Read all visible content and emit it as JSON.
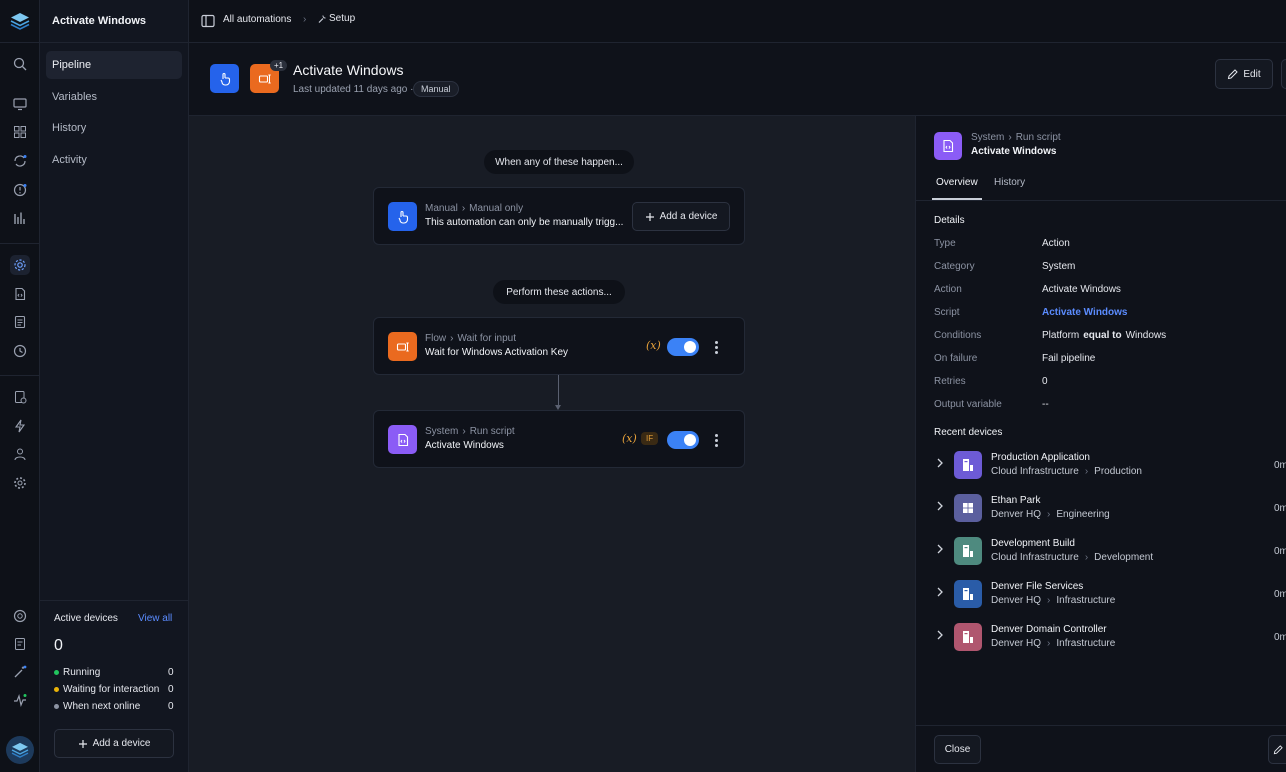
{
  "app": {
    "title": "Activate Windows"
  },
  "sidebar": {
    "nav": [
      {
        "label": "Pipeline"
      },
      {
        "label": "Variables"
      },
      {
        "label": "History"
      },
      {
        "label": "Activity"
      }
    ],
    "active_devices": {
      "title": "Active devices",
      "view_all": "View all",
      "count": "0",
      "statuses": [
        {
          "label": "Running",
          "value": "0",
          "color": "#22c55e"
        },
        {
          "label": "Waiting for interaction",
          "value": "0",
          "color": "#eab308"
        },
        {
          "label": "When next online",
          "value": "0",
          "color": "#8c93a3"
        }
      ],
      "add_button": "Add a device"
    }
  },
  "topbar": {
    "breadcrumb_root": "All automations",
    "breadcrumb_current": "Setup"
  },
  "header": {
    "title": "Activate Windows",
    "updated": "Last updated 11 days ago ·",
    "badge": "Manual",
    "plus_count": "+1",
    "edit_label": "Edit"
  },
  "canvas": {
    "trigger_heading": "When any of these happen...",
    "trigger": {
      "crumb_a": "Manual",
      "crumb_b": "Manual only",
      "desc": "This automation can only be manually trigg...",
      "add_device": "Add a device"
    },
    "actions_heading": "Perform these actions...",
    "actions": [
      {
        "crumb_a": "Flow",
        "crumb_b": "Wait for input",
        "title": "Wait for Windows Activation Key",
        "fx": "(x)"
      },
      {
        "crumb_a": "System",
        "crumb_b": "Run script",
        "title": "Activate Windows",
        "fx": "(x)",
        "if": "IF"
      }
    ]
  },
  "panel": {
    "crumb_a": "System",
    "crumb_b": "Run script",
    "title": "Activate Windows",
    "tabs": [
      {
        "label": "Overview"
      },
      {
        "label": "History"
      }
    ],
    "details_heading": "Details",
    "details": [
      {
        "k": "Type",
        "v": "Action"
      },
      {
        "k": "Category",
        "v": "System"
      },
      {
        "k": "Action",
        "v": "Activate Windows"
      },
      {
        "k": "Script",
        "v": "Activate Windows"
      },
      {
        "k": "Conditions",
        "v": ""
      },
      {
        "k": "On failure",
        "v": "Fail pipeline"
      },
      {
        "k": "Retries",
        "v": "0"
      },
      {
        "k": "Output variable",
        "v": "--"
      }
    ],
    "conditions": {
      "field": "Platform",
      "op": "equal to",
      "value": "Windows"
    },
    "recent_heading": "Recent devices",
    "devices": [
      {
        "name": "Production Application",
        "group": "Cloud Infrastructure",
        "sub": "Production",
        "time": "0m",
        "color": "#6d5bd6",
        "icon": "server-icon"
      },
      {
        "name": "Ethan Park",
        "group": "Denver HQ",
        "sub": "Engineering",
        "time": "0m",
        "color": "#5b5f9e",
        "icon": "windows-icon"
      },
      {
        "name": "Development Build",
        "group": "Cloud Infrastructure",
        "sub": "Development",
        "time": "0m",
        "color": "#4e8a7f",
        "icon": "server-icon"
      },
      {
        "name": "Denver File Services",
        "group": "Denver HQ",
        "sub": "Infrastructure",
        "time": "0m",
        "color": "#2a5ca8",
        "icon": "server-icon"
      },
      {
        "name": "Denver Domain Controller",
        "group": "Denver HQ",
        "sub": "Infrastructure",
        "time": "0m",
        "color": "#b0566f",
        "icon": "server-icon"
      }
    ],
    "close_label": "Close"
  },
  "colors": {
    "accent": "#3b82f6",
    "link": "#5b8cff",
    "orange": "#ea6a1f",
    "purple": "#8b5cf6",
    "blue": "#2563eb"
  }
}
